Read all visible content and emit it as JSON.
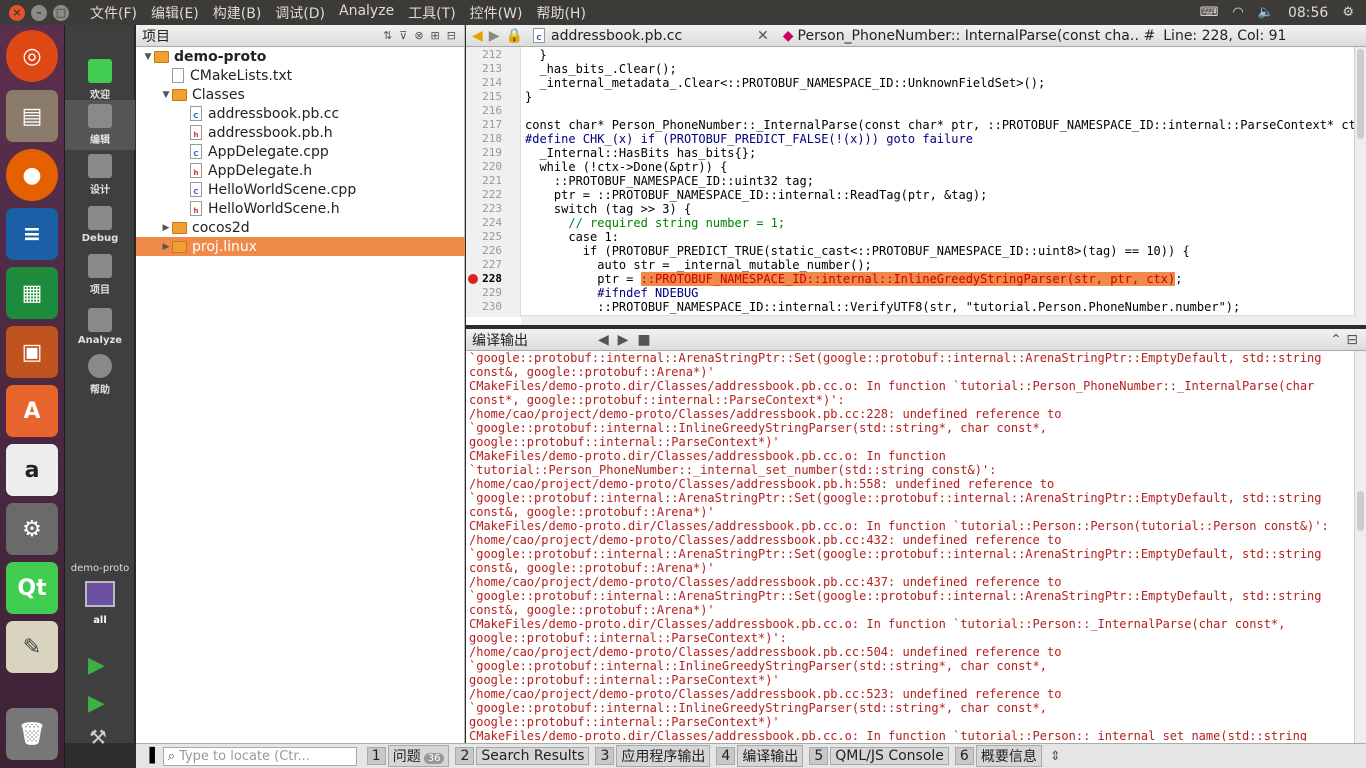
{
  "topbar": {
    "menus": [
      "文件(F)",
      "编辑(E)",
      "构建(B)",
      "调试(D)",
      "Analyze",
      "工具(T)",
      "控件(W)",
      "帮助(H)"
    ],
    "time": "08:56"
  },
  "modes": [
    {
      "label": "欢迎",
      "icon": "qt-welcome-icon"
    },
    {
      "label": "编辑",
      "icon": "edit-icon",
      "active": true
    },
    {
      "label": "设计",
      "icon": "design-icon"
    },
    {
      "label": "Debug",
      "icon": "debug-icon"
    },
    {
      "label": "项目",
      "icon": "project-icon"
    },
    {
      "label": "Analyze",
      "icon": "analyze-icon"
    },
    {
      "label": "帮助",
      "icon": "help-icon"
    }
  ],
  "kit": {
    "project": "demo-proto",
    "build": "all"
  },
  "project_pane": {
    "title": "项目",
    "tree": [
      {
        "label": "demo-proto",
        "type": "folder",
        "depth": 0,
        "expanded": true,
        "bold": true
      },
      {
        "label": "CMakeLists.txt",
        "type": "file",
        "depth": 1
      },
      {
        "label": "Classes",
        "type": "folder",
        "depth": 1,
        "expanded": true
      },
      {
        "label": "addressbook.pb.cc",
        "type": "cpp",
        "depth": 2
      },
      {
        "label": "addressbook.pb.h",
        "type": "h",
        "depth": 2
      },
      {
        "label": "AppDelegate.cpp",
        "type": "cpp",
        "depth": 2
      },
      {
        "label": "AppDelegate.h",
        "type": "h",
        "depth": 2
      },
      {
        "label": "HelloWorldScene.cpp",
        "type": "cpp",
        "depth": 2
      },
      {
        "label": "HelloWorldScene.h",
        "type": "h",
        "depth": 2
      },
      {
        "label": "cocos2d",
        "type": "folder",
        "depth": 1,
        "expanded": false
      },
      {
        "label": "proj.linux",
        "type": "folder",
        "depth": 1,
        "expanded": false,
        "selected": true
      }
    ]
  },
  "editor": {
    "file": "addressbook.pb.cc",
    "symbol": "Person_PhoneNumber:: InternalParse(const cha…",
    "position": "Line: 228, Col: 91",
    "lines": [
      {
        "n": "212",
        "text": "  }"
      },
      {
        "n": "213",
        "text": "  _has_bits_.Clear();"
      },
      {
        "n": "214",
        "text": "  _internal_metadata_.Clear<::PROTOBUF_NAMESPACE_ID::UnknownFieldSet>();"
      },
      {
        "n": "215",
        "text": "}"
      },
      {
        "n": "216",
        "text": ""
      },
      {
        "n": "217",
        "text": "const char* Person_PhoneNumber::_InternalParse(const char* ptr, ::PROTOBUF_NAMESPACE_ID::internal::ParseContext* ctx) {"
      },
      {
        "n": "218",
        "text": "#define CHK_(x) if (PROTOBUF_PREDICT_FALSE(!(x))) goto failure"
      },
      {
        "n": "219",
        "text": "  _Internal::HasBits has_bits{};"
      },
      {
        "n": "220",
        "text": "  while (!ctx->Done(&ptr)) {"
      },
      {
        "n": "221",
        "text": "    ::PROTOBUF_NAMESPACE_ID::uint32 tag;"
      },
      {
        "n": "222",
        "text": "    ptr = ::PROTOBUF_NAMESPACE_ID::internal::ReadTag(ptr, &tag);"
      },
      {
        "n": "223",
        "text": "    switch (tag >> 3) {"
      },
      {
        "n": "224",
        "text": "      // required string number = 1;"
      },
      {
        "n": "225",
        "text": "      case 1:"
      },
      {
        "n": "226",
        "text": "        if (PROTOBUF_PREDICT_TRUE(static_cast<::PROTOBUF_NAMESPACE_ID::uint8>(tag) == 10)) {"
      },
      {
        "n": "227",
        "text": "          auto str = _internal_mutable_number();"
      },
      {
        "n": "228",
        "pre": "          ptr = ",
        "hl": "::PROTOBUF_NAMESPACE_ID::internal::InlineGreedyStringParser(str, ptr, ctx)",
        "post": ";"
      },
      {
        "n": "229",
        "text": "          #ifndef NDEBUG"
      },
      {
        "n": "230",
        "text": "          ::PROTOBUF_NAMESPACE_ID::internal::VerifyUTF8(str, \"tutorial.Person.PhoneNumber.number\");"
      }
    ]
  },
  "output": {
    "title": "编译输出",
    "text": "`google::protobuf::internal::ArenaStringPtr::Set(google::protobuf::internal::ArenaStringPtr::EmptyDefault, std::string\nconst&, google::protobuf::Arena*)'\nCMakeFiles/demo-proto.dir/Classes/addressbook.pb.cc.o: In function `tutorial::Person_PhoneNumber::_InternalParse(char\nconst*, google::protobuf::internal::ParseContext*)':\n/home/cao/project/demo-proto/Classes/addressbook.pb.cc:228: undefined reference to\n`google::protobuf::internal::InlineGreedyStringParser(std::string*, char const*,\ngoogle::protobuf::internal::ParseContext*)'\nCMakeFiles/demo-proto.dir/Classes/addressbook.pb.cc.o: In function\n`tutorial::Person_PhoneNumber::_internal_set_number(std::string const&)':\n/home/cao/project/demo-proto/Classes/addressbook.pb.h:558: undefined reference to\n`google::protobuf::internal::ArenaStringPtr::Set(google::protobuf::internal::ArenaStringPtr::EmptyDefault, std::string\nconst&, google::protobuf::Arena*)'\nCMakeFiles/demo-proto.dir/Classes/addressbook.pb.cc.o: In function `tutorial::Person::Person(tutorial::Person const&)':\n/home/cao/project/demo-proto/Classes/addressbook.pb.cc:432: undefined reference to\n`google::protobuf::internal::ArenaStringPtr::Set(google::protobuf::internal::ArenaStringPtr::EmptyDefault, std::string\nconst&, google::protobuf::Arena*)'\n/home/cao/project/demo-proto/Classes/addressbook.pb.cc:437: undefined reference to\n`google::protobuf::internal::ArenaStringPtr::Set(google::protobuf::internal::ArenaStringPtr::EmptyDefault, std::string\nconst&, google::protobuf::Arena*)'\nCMakeFiles/demo-proto.dir/Classes/addressbook.pb.cc.o: In function `tutorial::Person::_InternalParse(char const*,\ngoogle::protobuf::internal::ParseContext*)':\n/home/cao/project/demo-proto/Classes/addressbook.pb.cc:504: undefined reference to\n`google::protobuf::internal::InlineGreedyStringParser(std::string*, char const*,\ngoogle::protobuf::internal::ParseContext*)'\n/home/cao/project/demo-proto/Classes/addressbook.pb.cc:523: undefined reference to\n`google::protobuf::internal::InlineGreedyStringParser(std::string*, char const*,\ngoogle::protobuf::internal::ParseContext*)'\nCMakeFiles/demo-proto.dir/Classes/addressbook.pb.cc.o: In function `tutorial::Person::_internal_set_name(std::string"
  },
  "bottom": {
    "locate_placeholder": "Type to locate (Ctr...",
    "tabs": [
      {
        "n": "1",
        "label": "问题",
        "badge": "36"
      },
      {
        "n": "2",
        "label": "Search Results"
      },
      {
        "n": "3",
        "label": "应用程序输出"
      },
      {
        "n": "4",
        "label": "编译输出"
      },
      {
        "n": "5",
        "label": "QML/JS Console"
      },
      {
        "n": "6",
        "label": "概要信息"
      }
    ]
  }
}
